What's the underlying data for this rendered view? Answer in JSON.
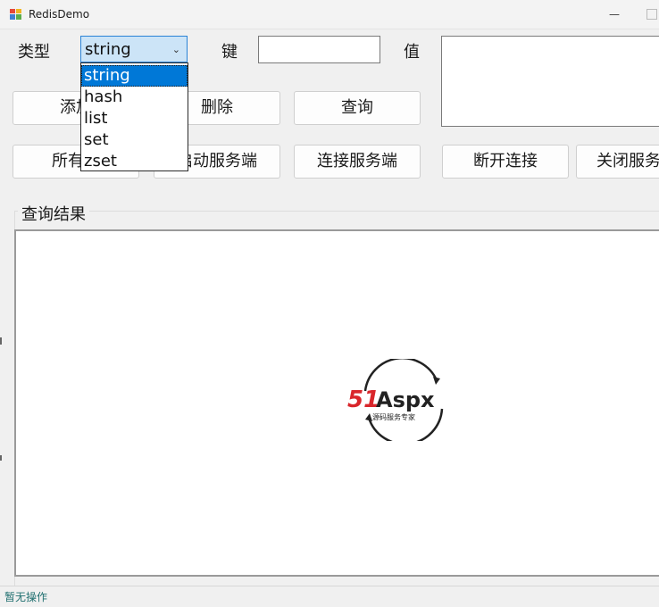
{
  "window": {
    "title": "RedisDemo"
  },
  "form": {
    "type_label": "类型",
    "type_selected": "string",
    "type_options": [
      "string",
      "hash",
      "list",
      "set",
      "zset"
    ],
    "key_label": "键",
    "value_label": "值"
  },
  "buttons": {
    "add": "添加",
    "delete": "删除",
    "query": "查询",
    "all_keys": "所有键",
    "start_server": "启动服务端",
    "connect_server": "连接服务端",
    "disconnect": "断开连接",
    "close_server": "关闭服务端"
  },
  "results": {
    "title": "查询结果"
  },
  "watermark": {
    "brand_51": "51",
    "brand_aspx": "Aspx",
    "slogan": "源码服务专家"
  },
  "status": {
    "text": "暂无操作"
  }
}
